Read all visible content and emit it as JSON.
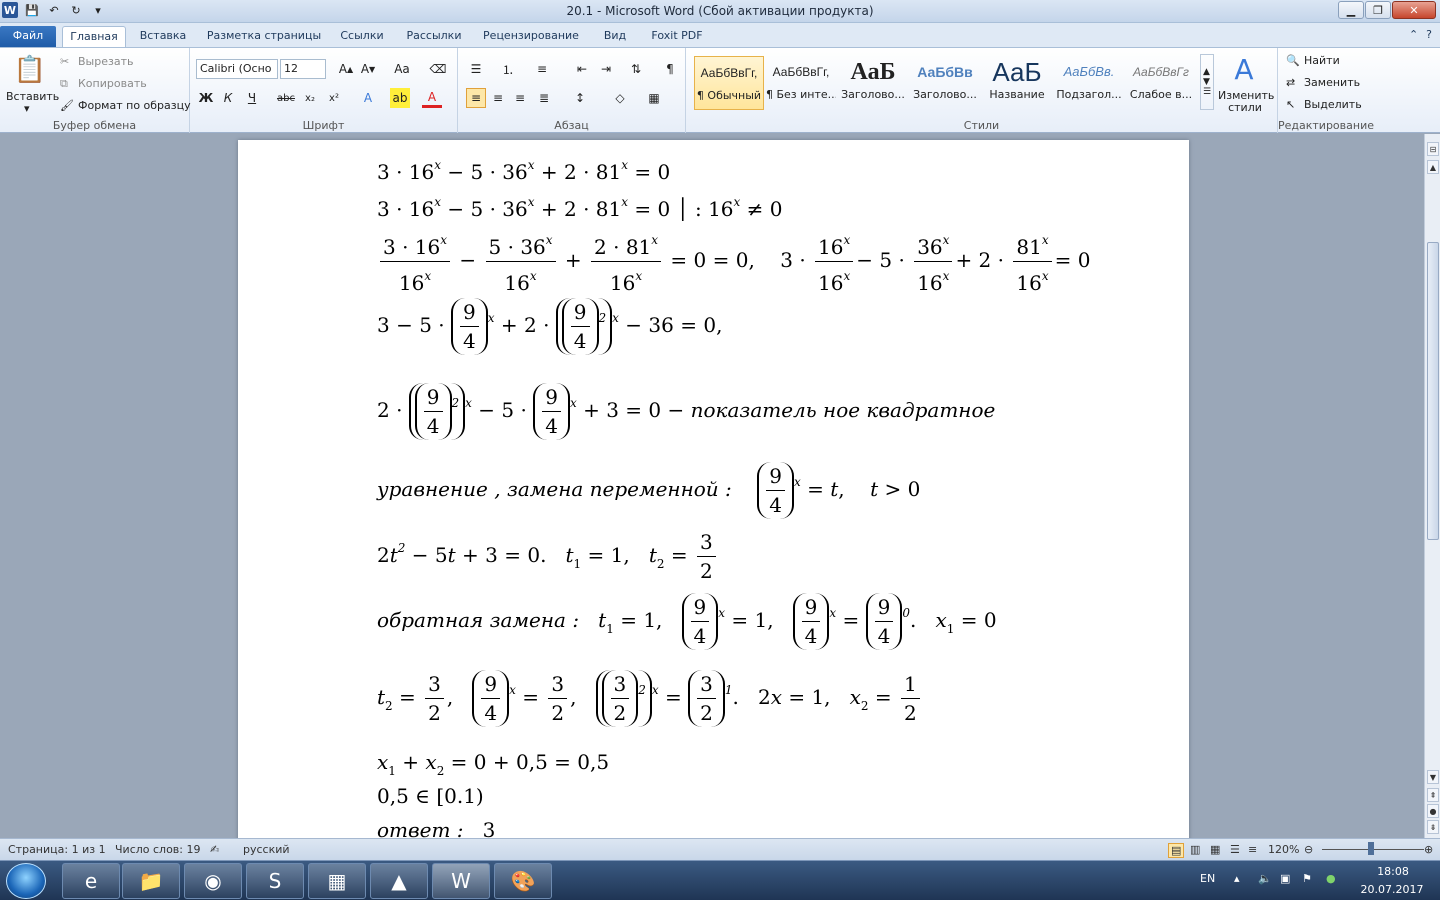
{
  "window": {
    "title": "20.1  -  Microsoft Word (Сбой активации продукта)"
  },
  "tabs": [
    "Файл",
    "Главная",
    "Вставка",
    "Разметка страницы",
    "Ссылки",
    "Рассылки",
    "Рецензирование",
    "Вид",
    "Foxit PDF"
  ],
  "clipboard": {
    "paste": "Вставить",
    "cut": "Вырезать",
    "copy": "Копировать",
    "format_painter": "Формат по образцу",
    "label": "Буфер обмена"
  },
  "font": {
    "family": "Calibri (Осно",
    "size": "12",
    "label": "Шрифт"
  },
  "paragraph": {
    "label": "Абзац"
  },
  "styles": {
    "label": "Стили",
    "change": "Изменить стили",
    "items": [
      {
        "sample": "АаБбВвГг,",
        "name": "¶ Обычный"
      },
      {
        "sample": "АаБбВвГг,",
        "name": "¶ Без инте..."
      },
      {
        "sample": "АаБ",
        "name": "Заголово..."
      },
      {
        "sample": "АаБбВв",
        "name": "Заголово..."
      },
      {
        "sample": "АаБ",
        "name": "Название"
      },
      {
        "sample": "АаБбВв.",
        "name": "Подзагол..."
      },
      {
        "sample": "АаБбВвГг",
        "name": "Слабое в..."
      }
    ]
  },
  "editing": {
    "find": "Найти",
    "replace": "Заменить",
    "select": "Выделить",
    "label": "Редактирование"
  },
  "doc": {
    "words": {
      "indicative": "показатель ное квадратное",
      "equation": "уравнение , замена переменной :",
      "reverse": "обратная замена :",
      "answer": "ответ :"
    },
    "answer_value": "3"
  },
  "status": {
    "page": "Страница: 1 из 1",
    "words": "Число слов: 19",
    "lang": "русский",
    "zoom": "120%"
  },
  "tray": {
    "lang": "EN",
    "time": "18:08",
    "date": "20.07.2017"
  }
}
